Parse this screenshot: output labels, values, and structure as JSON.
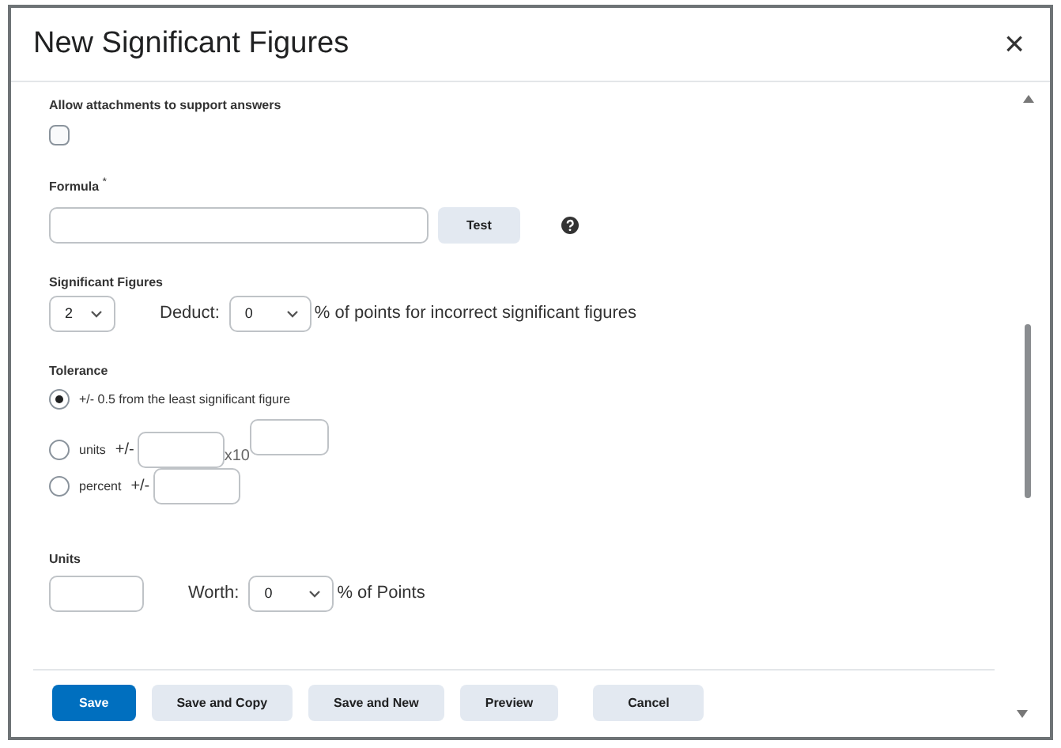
{
  "dialog": {
    "title": "New Significant Figures",
    "close": "×"
  },
  "attachments": {
    "label": "Allow attachments to support answers",
    "checked": false
  },
  "formula": {
    "label": "Formula",
    "required_mark": "*",
    "test_button": "Test"
  },
  "significant_figures": {
    "label": "Significant Figures",
    "value": "2",
    "deduct_label": "Deduct:",
    "deduct_value": "0",
    "deduct_suffix": "% of points for incorrect significant figures"
  },
  "tolerance": {
    "label": "Tolerance",
    "options": [
      {
        "kind": "plain",
        "label": "+/- 0.5 from the least significant figure",
        "selected": true
      },
      {
        "kind": "units",
        "label": "units",
        "pm": "+/-",
        "times": "x10",
        "selected": false
      },
      {
        "kind": "percent",
        "label": "percent",
        "pm": "+/-",
        "selected": false
      }
    ]
  },
  "units": {
    "label": "Units",
    "worth_label": "Worth:",
    "worth_value": "0",
    "worth_suffix": "% of Points"
  },
  "footer": {
    "buttons": [
      {
        "label": "Save",
        "primary": true
      },
      {
        "label": "Save and Copy",
        "primary": false
      },
      {
        "label": "Save and New",
        "primary": false
      },
      {
        "label": "Preview",
        "primary": false
      },
      {
        "label": "Cancel",
        "primary": false
      }
    ]
  }
}
